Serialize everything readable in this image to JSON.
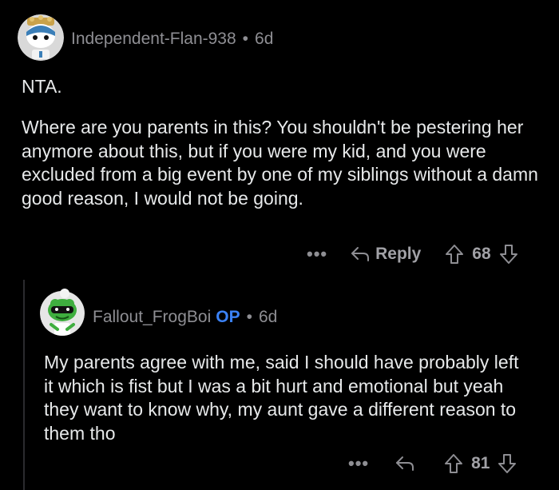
{
  "comment1": {
    "author": "Independent-Flan-938",
    "age": "6d",
    "paragraphs": [
      "NTA.",
      "Where are you parents in this? You shouldn't be pestering her anymore about this, but if you were my kid, and you were excluded from a big event by one of my siblings without a damn good reason, I would not be going."
    ],
    "more_label": "•••",
    "reply_label": "Reply",
    "vote_count": "68"
  },
  "comment2": {
    "author": "Fallout_FrogBoi",
    "op_badge": "OP",
    "age": "6d",
    "text": "My parents agree with me, said I should have probably left it which is fist but I was a bit hurt and emotional but yeah they want to know why, my aunt gave a different reason to them tho",
    "more_label": "•••",
    "vote_count": "81"
  },
  "separator": "•",
  "colors": {
    "background": "#000000",
    "text": "#e7e9ea",
    "muted": "#8e8e93",
    "op_badge": "#3b82f6"
  }
}
